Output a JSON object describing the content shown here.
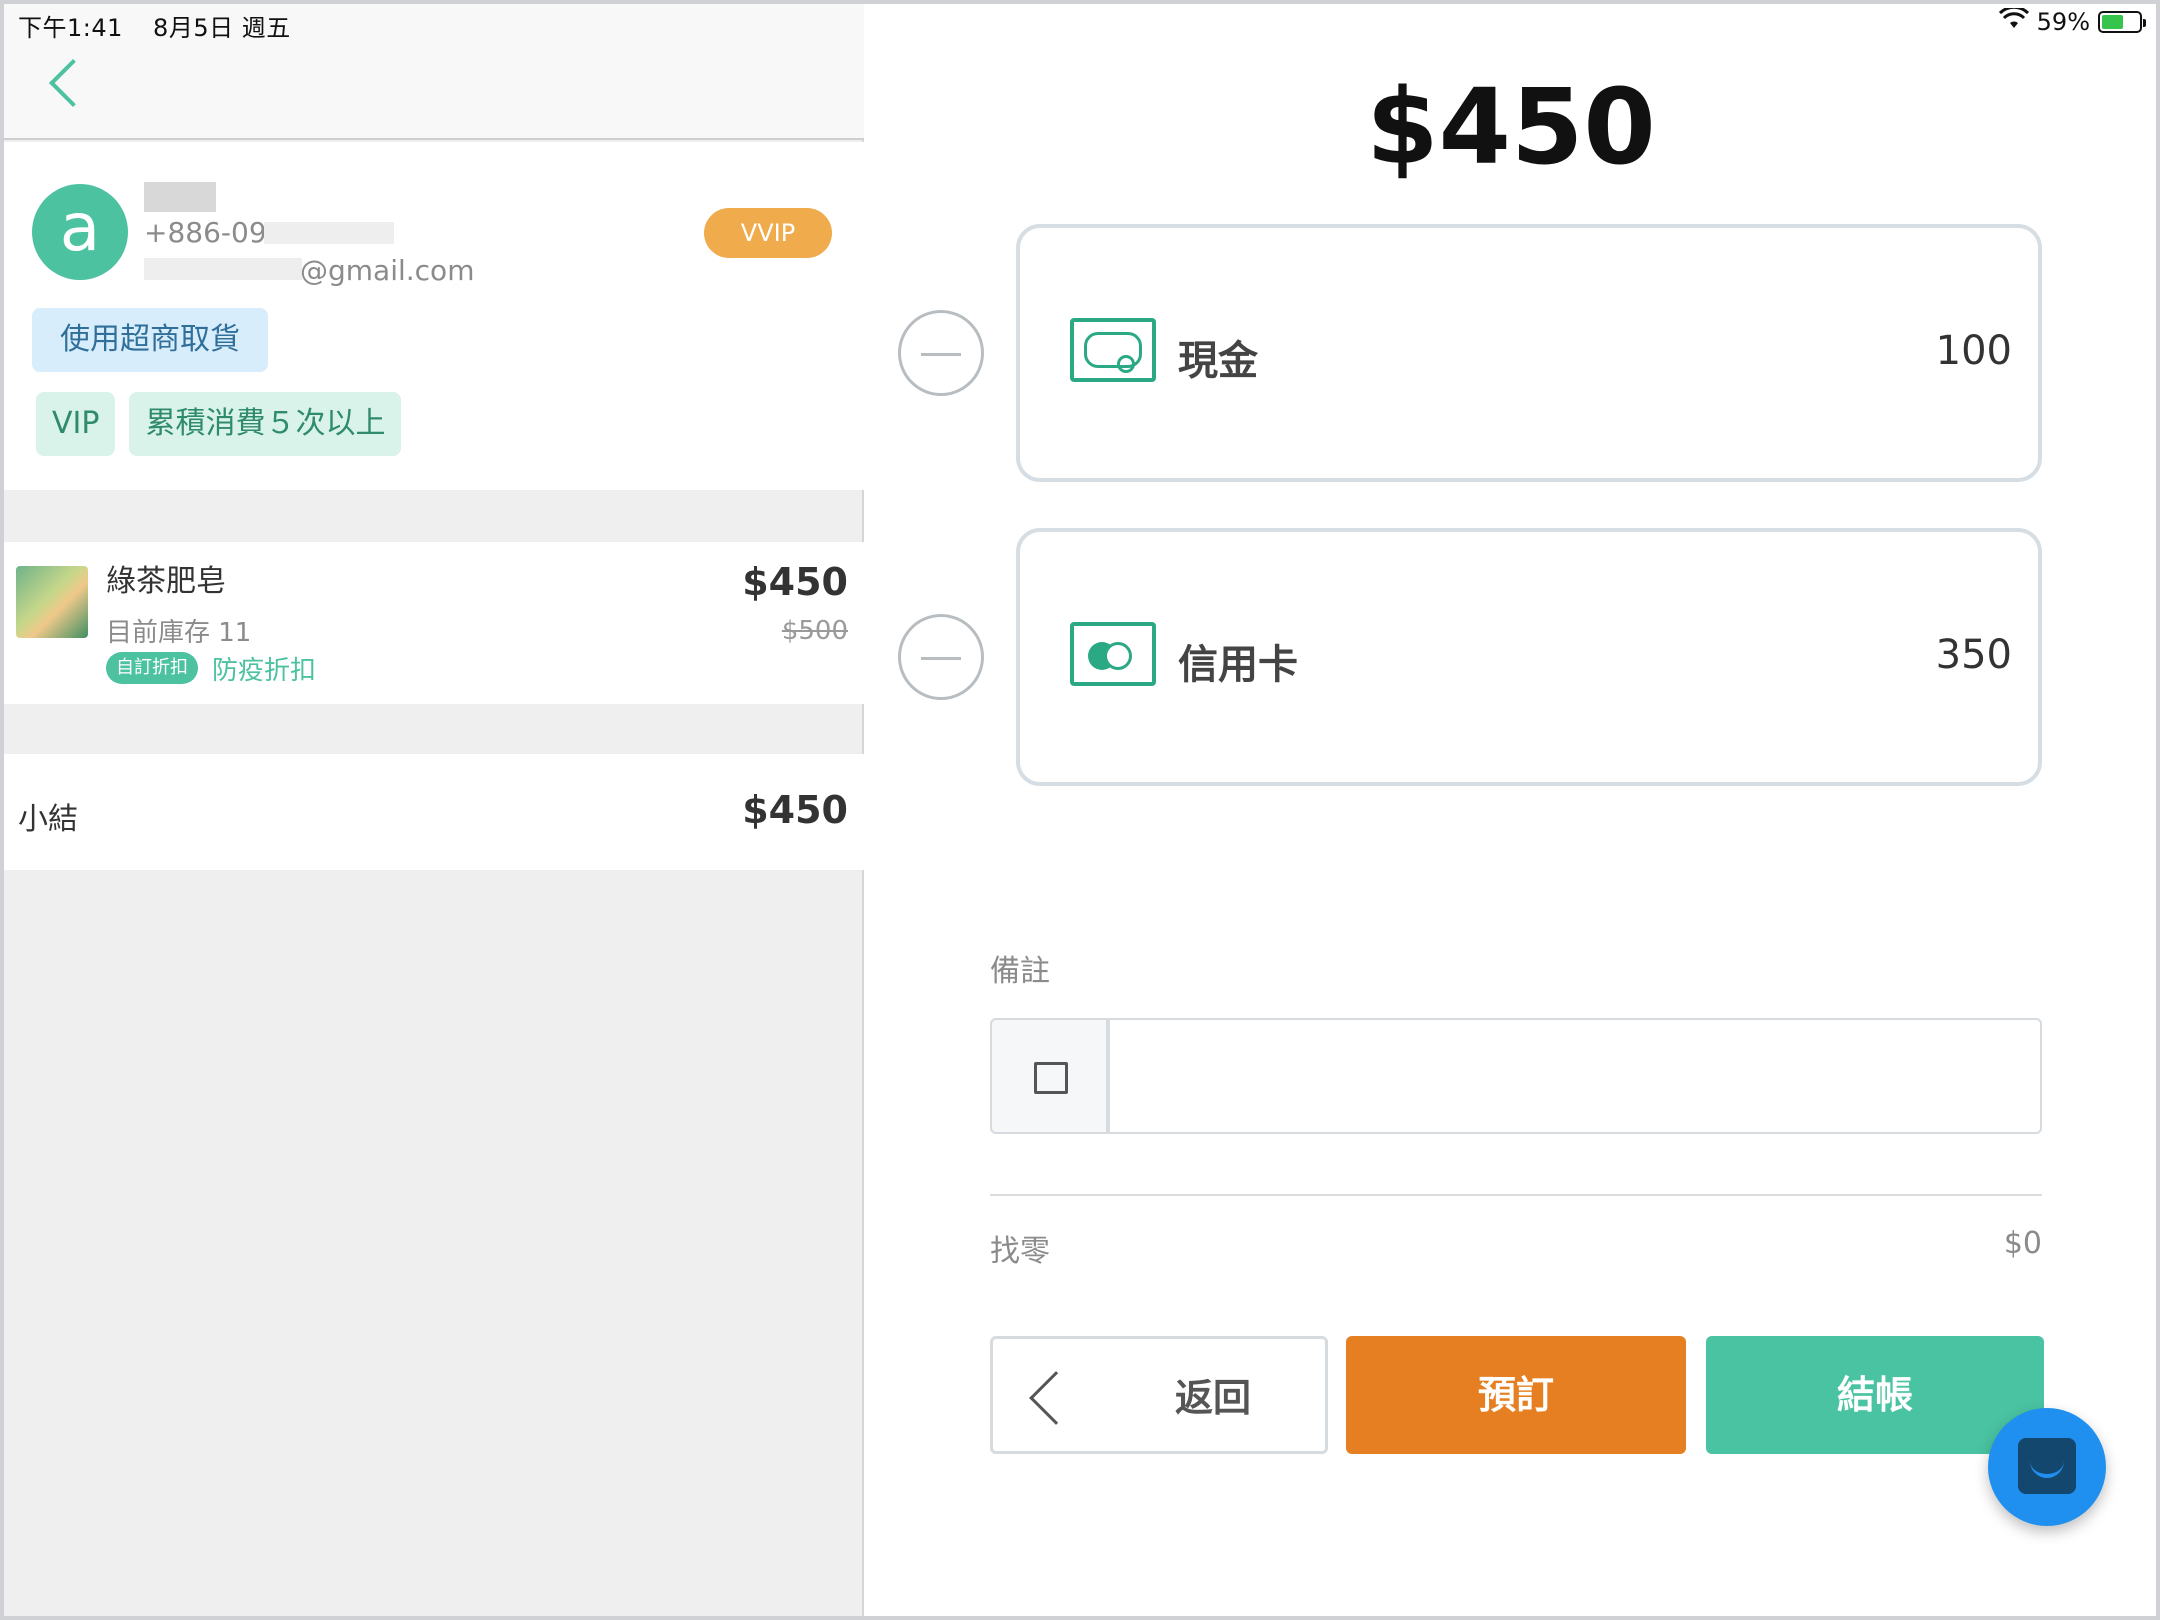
{
  "status_bar": {
    "time": "下午1:41",
    "date": "8月5日 週五",
    "battery": "59%"
  },
  "customer": {
    "avatar_letter": "a",
    "phone_prefix": "+886-09",
    "email_suffix": "@gmail.com",
    "level_badge": "VVIP",
    "pickup_tag": "使用超商取貨",
    "tags": [
      "VIP",
      "累積消費５次以上"
    ]
  },
  "cart": {
    "item": {
      "name": "綠茶肥皂",
      "stock": "目前庫存 11",
      "badge": "自訂折扣",
      "discount_name": "防疫折扣",
      "price": "$450",
      "original_price": "$500"
    },
    "subtotal_label": "小結",
    "subtotal_value": "$450"
  },
  "checkout": {
    "total": "$450",
    "payments": [
      {
        "name": "現金",
        "amount": "100",
        "icon": "cash-icon"
      },
      {
        "name": "信用卡",
        "amount": "350",
        "icon": "credit-card-icon"
      }
    ],
    "note_label": "備註",
    "note_value": "",
    "change_label": "找零",
    "change_value": "$0",
    "buttons": {
      "back": "返回",
      "reserve": "預訂",
      "checkout": "結帳"
    },
    "colors": {
      "accent": "#49c3a1",
      "reserve": "#e57f22",
      "fab": "#1f8ff0"
    }
  }
}
